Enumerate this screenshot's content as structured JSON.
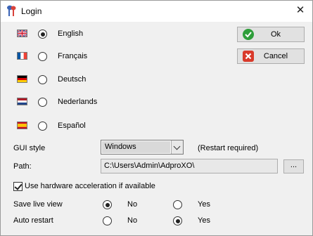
{
  "window": {
    "title": "Login",
    "close_glyph": "✕"
  },
  "languages": [
    {
      "label": "English",
      "flag": "uk",
      "selected": true
    },
    {
      "label": "Français",
      "flag": "france",
      "selected": false
    },
    {
      "label": "Deutsch",
      "flag": "germany",
      "selected": false
    },
    {
      "label": "Nederlands",
      "flag": "netherlands",
      "selected": false
    },
    {
      "label": "Español",
      "flag": "spain",
      "selected": false
    }
  ],
  "buttons": {
    "ok": {
      "label": "Ok",
      "icon": "check-icon",
      "color": "#2e9e3a"
    },
    "cancel": {
      "label": "Cancel",
      "icon": "cross-icon",
      "color": "#d93a2b"
    }
  },
  "gui_style": {
    "label": "GUI style",
    "value": "Windows",
    "note": "(Restart required)"
  },
  "path": {
    "label": "Path:",
    "value": "C:\\Users\\Admin\\AdproXO\\",
    "browse_label": "..."
  },
  "hardware_acceleration": {
    "label": "Use hardware acceleration if available",
    "checked": true
  },
  "save_live_view": {
    "label": "Save live view",
    "no_label": "No",
    "yes_label": "Yes",
    "value": "No"
  },
  "auto_restart": {
    "label": "Auto restart",
    "no_label": "No",
    "yes_label": "Yes",
    "value": "Yes"
  },
  "colors": {
    "accent_blue": "#0078d7",
    "window_bg": "#f0f0f0"
  }
}
